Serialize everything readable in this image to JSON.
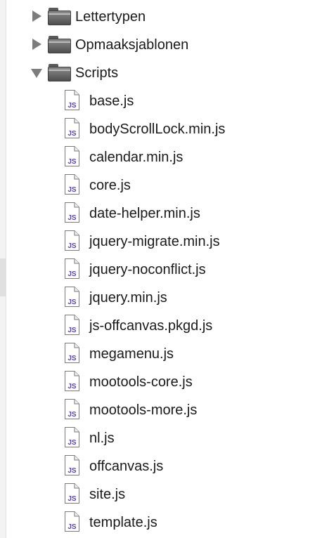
{
  "folders": [
    {
      "label": "Lettertypen",
      "expanded": false,
      "icon": "folder-icon"
    },
    {
      "label": "Opmaaksjablonen",
      "expanded": false,
      "icon": "folder-icon"
    },
    {
      "label": "Scripts",
      "expanded": true,
      "icon": "folder-icon"
    }
  ],
  "scripts_files": [
    {
      "label": "base.js",
      "icon": "js-file-icon"
    },
    {
      "label": "bodyScrollLock.min.js",
      "icon": "js-file-icon"
    },
    {
      "label": "calendar.min.js",
      "icon": "js-file-icon"
    },
    {
      "label": "core.js",
      "icon": "js-file-icon"
    },
    {
      "label": "date-helper.min.js",
      "icon": "js-file-icon"
    },
    {
      "label": "jquery-migrate.min.js",
      "icon": "js-file-icon"
    },
    {
      "label": "jquery-noconflict.js",
      "icon": "js-file-icon"
    },
    {
      "label": "jquery.min.js",
      "icon": "js-file-icon"
    },
    {
      "label": "js-offcanvas.pkgd.js",
      "icon": "js-file-icon"
    },
    {
      "label": "megamenu.js",
      "icon": "js-file-icon"
    },
    {
      "label": "mootools-core.js",
      "icon": "js-file-icon"
    },
    {
      "label": "mootools-more.js",
      "icon": "js-file-icon"
    },
    {
      "label": "nl.js",
      "icon": "js-file-icon"
    },
    {
      "label": "offcanvas.js",
      "icon": "js-file-icon"
    },
    {
      "label": "site.js",
      "icon": "js-file-icon"
    },
    {
      "label": "template.js",
      "icon": "js-file-icon"
    }
  ],
  "js_badge": "JS",
  "colors": {
    "js_badge": "#5b3fb8",
    "folder": "#6b6b6b",
    "text": "#1a1a1a"
  }
}
